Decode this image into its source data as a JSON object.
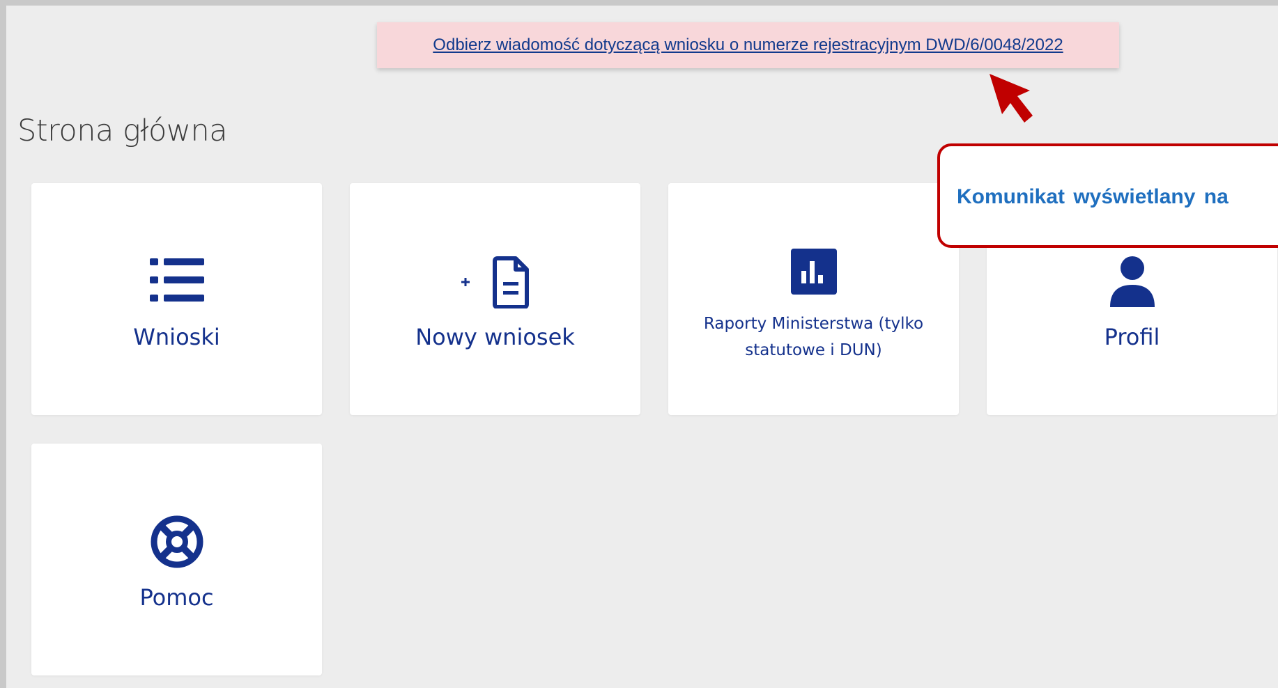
{
  "notice": {
    "link_text": "Odbierz wiadomość dotyczącą wniosku o numerze rejestracyjnym DWD/6/0048/2022"
  },
  "page": {
    "title": "Strona główna"
  },
  "tiles": [
    {
      "label": "Wnioski",
      "icon": "list-icon"
    },
    {
      "label": "Nowy wniosek",
      "icon": "new-document-icon"
    },
    {
      "label": "Raporty Ministerstwa (tylko statutowe i DUN)",
      "icon": "bar-chart-icon"
    },
    {
      "label": "Profil",
      "icon": "user-icon"
    },
    {
      "label": "Pomoc",
      "icon": "lifebuoy-icon"
    }
  ],
  "annotation": {
    "callout_text": "Komunikat wyświetlany na",
    "colors": {
      "border": "#c00000",
      "text": "#1f6fbf",
      "arrow": "#c00000"
    }
  },
  "colors": {
    "tile_text": "#14318c",
    "notice_background": "#f8d7da",
    "page_background": "#ededed"
  }
}
